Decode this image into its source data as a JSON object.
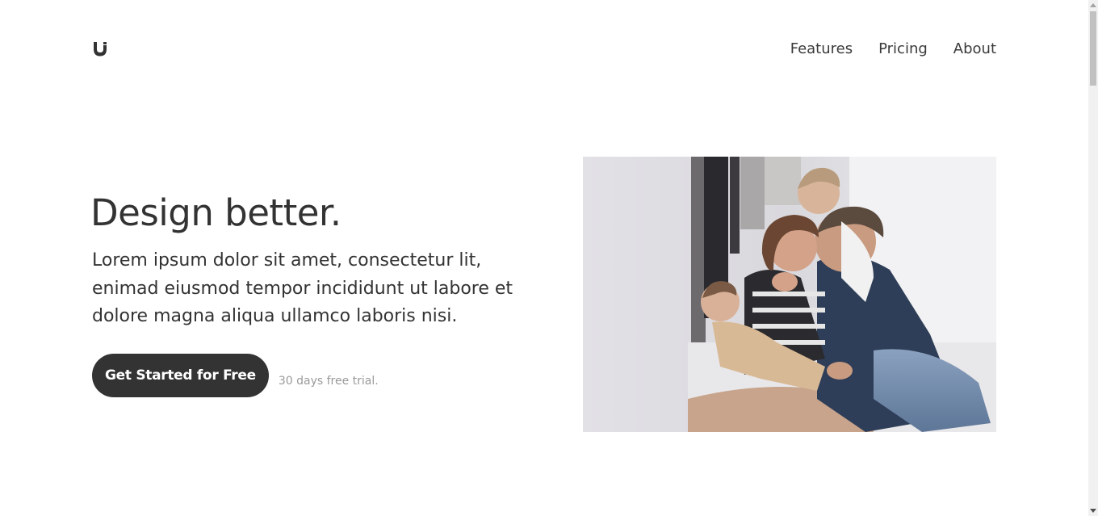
{
  "header": {
    "logo_icon": "brand-logo-icon",
    "nav": [
      {
        "label": "Features"
      },
      {
        "label": "Pricing"
      },
      {
        "label": "About"
      }
    ]
  },
  "hero": {
    "title": "Design better.",
    "body": "Lorem ipsum dolor sit amet, consectetur lit, enimad eiusmod tempor incididunt ut labore et dolore magna aliqua ullamco laboris nisi.",
    "cta_label": "Get Started for Free",
    "trial_note": "30 days free trial.",
    "image_alt": "family-photo"
  },
  "colors": {
    "text": "#333333",
    "button_bg": "#333333",
    "button_text": "#ffffff",
    "muted": "#9a9a9a"
  }
}
